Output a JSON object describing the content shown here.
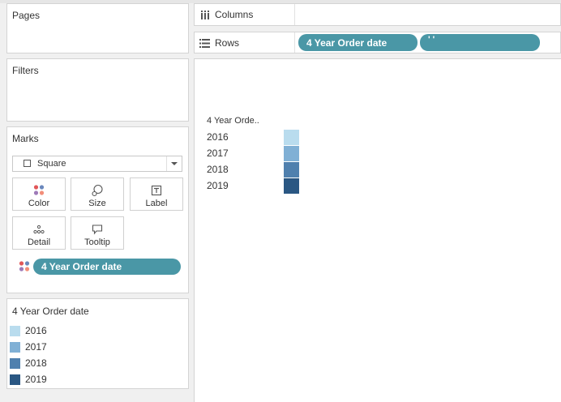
{
  "pages": {
    "title": "Pages"
  },
  "filters": {
    "title": "Filters"
  },
  "marks": {
    "title": "Marks",
    "mark_type": "Square",
    "buttons": {
      "color": "Color",
      "size": "Size",
      "label": "Label",
      "detail": "Detail",
      "tooltip": "Tooltip"
    },
    "color_pill": "4 Year Order date"
  },
  "legend": {
    "title": "4 Year Order date",
    "items": [
      {
        "label": "2016",
        "color": "#b9dcee"
      },
      {
        "label": "2017",
        "color": "#80b0d5"
      },
      {
        "label": "2018",
        "color": "#4f80ae"
      },
      {
        "label": "2019",
        "color": "#2a5783"
      }
    ]
  },
  "shelves": {
    "columns_label": "Columns",
    "rows_label": "Rows",
    "rows_pills": [
      "4 Year Order date",
      "' '"
    ]
  },
  "view": {
    "header": "4 Year Orde..",
    "rows": [
      {
        "label": "2016",
        "color": "#b9dcee"
      },
      {
        "label": "2017",
        "color": "#80b0d5"
      },
      {
        "label": "2018",
        "color": "#4f80ae"
      },
      {
        "label": "2019",
        "color": "#2a5783"
      }
    ]
  },
  "colors": {
    "pill": "#4a97a6"
  }
}
